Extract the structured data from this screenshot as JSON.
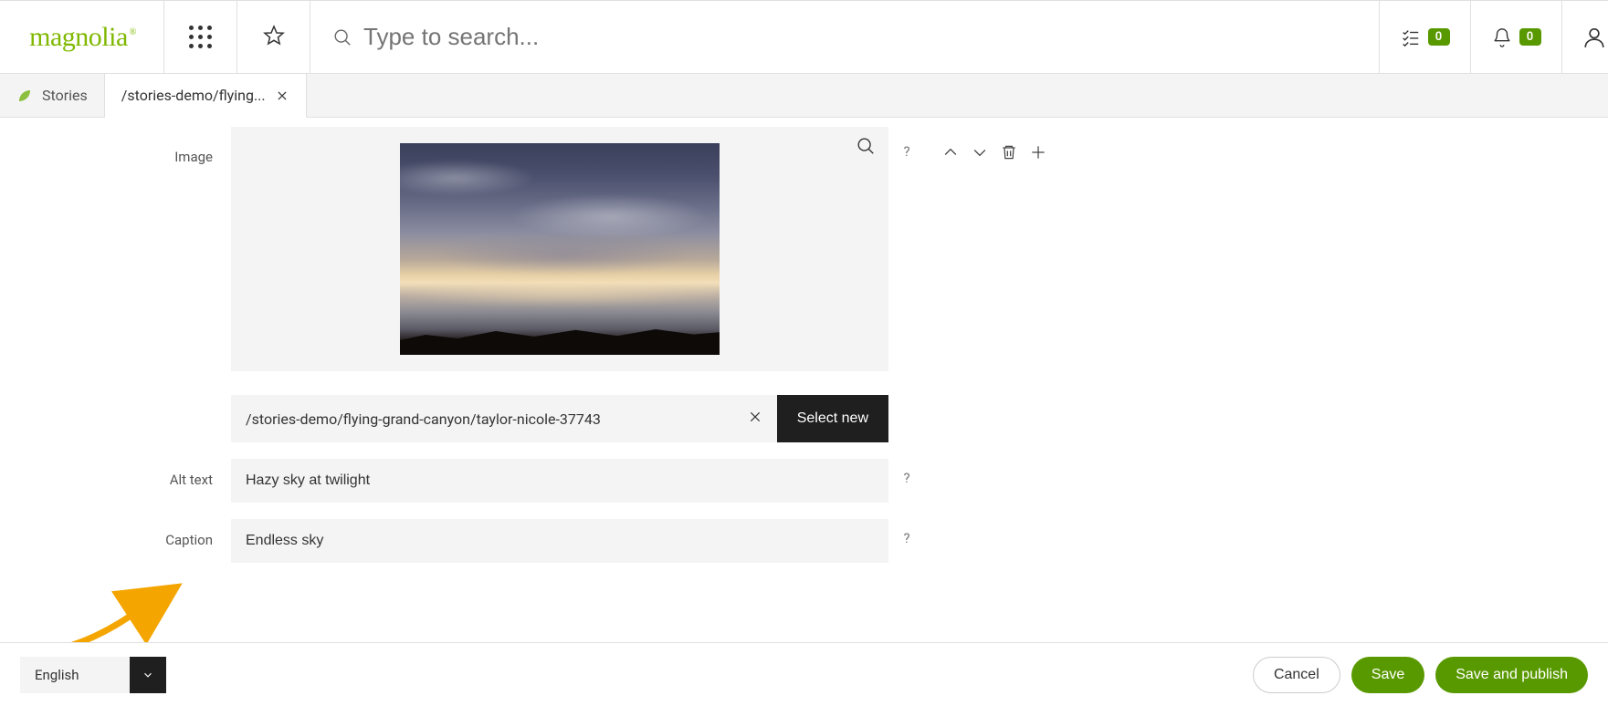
{
  "header": {
    "logo_text": "magnolia",
    "search_placeholder": "Type to search...",
    "tasks_badge": "0",
    "notifications_badge": "0"
  },
  "tabs": {
    "back_label": "Stories",
    "active_label": "/stories-demo/flying..."
  },
  "form": {
    "image_label": "Image",
    "image_path": "/stories-demo/flying-grand-canyon/taylor-nicole-37743",
    "select_new_label": "Select new",
    "alt_text_label": "Alt text",
    "alt_text_value": "Hazy sky at twilight",
    "caption_label": "Caption",
    "caption_value": "Endless sky",
    "help_symbol": "?"
  },
  "footer": {
    "language": "English",
    "cancel": "Cancel",
    "save": "Save",
    "save_publish": "Save and publish"
  },
  "colors": {
    "brand_green": "#7fb800",
    "action_green": "#599900"
  }
}
